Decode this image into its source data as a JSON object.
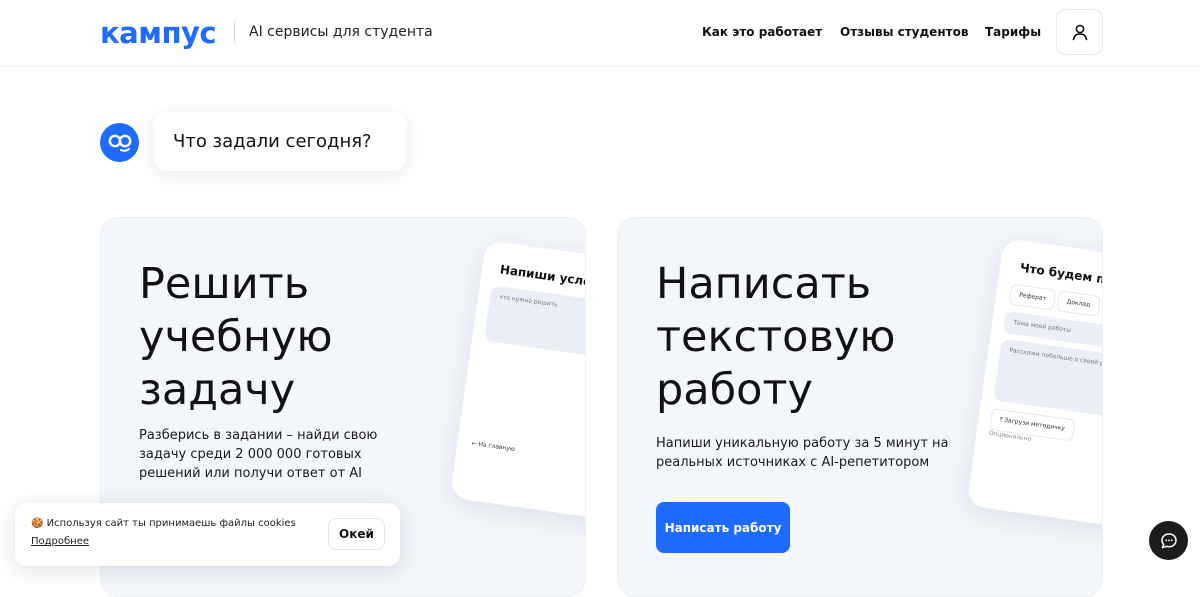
{
  "header": {
    "logo": "кампус",
    "tagline": "AI сервисы для студента",
    "nav": [
      "Как это работает",
      "Отзывы студентов",
      "Тарифы"
    ],
    "profile_icon": "user-icon"
  },
  "hero": {
    "bot_icon": "bot-face-icon",
    "question": "Что задали сегодня?"
  },
  "cards": [
    {
      "title_lines": [
        "Решить",
        "учебную",
        "задачу"
      ],
      "description": "Разберись в задании – найди свою задачу среди 2 000 000 готовых решений или получи ответ от AI",
      "mock": {
        "title": "Напиши услови",
        "field_placeholder": "что нужно решить",
        "back_label": "На главную"
      }
    },
    {
      "title_lines": [
        "Написать",
        "текстовую",
        "работу"
      ],
      "description": "Напиши уникальную работу за 5 минут на реальных источниках с AI-репетитором",
      "button": "Написать работу",
      "mock": {
        "title": "Что будем пис",
        "chips": [
          "Реферат",
          "Доклад"
        ],
        "topic_placeholder": "Тема моей работы",
        "details_placeholder": "Расскажи побольше о своей работе",
        "upload_label": "Загрузи методичку",
        "optional_label": "Опционально"
      }
    }
  ],
  "cookie": {
    "icon": "cookie-icon",
    "text": "Используя сайт ты принимаешь файлы cookies",
    "link": "Подробнее",
    "button": "Окей"
  },
  "chat": {
    "icon": "chat-icon"
  },
  "colors": {
    "accent": "#1f6bff",
    "card_bg": "#f3f6fb",
    "dark": "#1c1c1c"
  }
}
